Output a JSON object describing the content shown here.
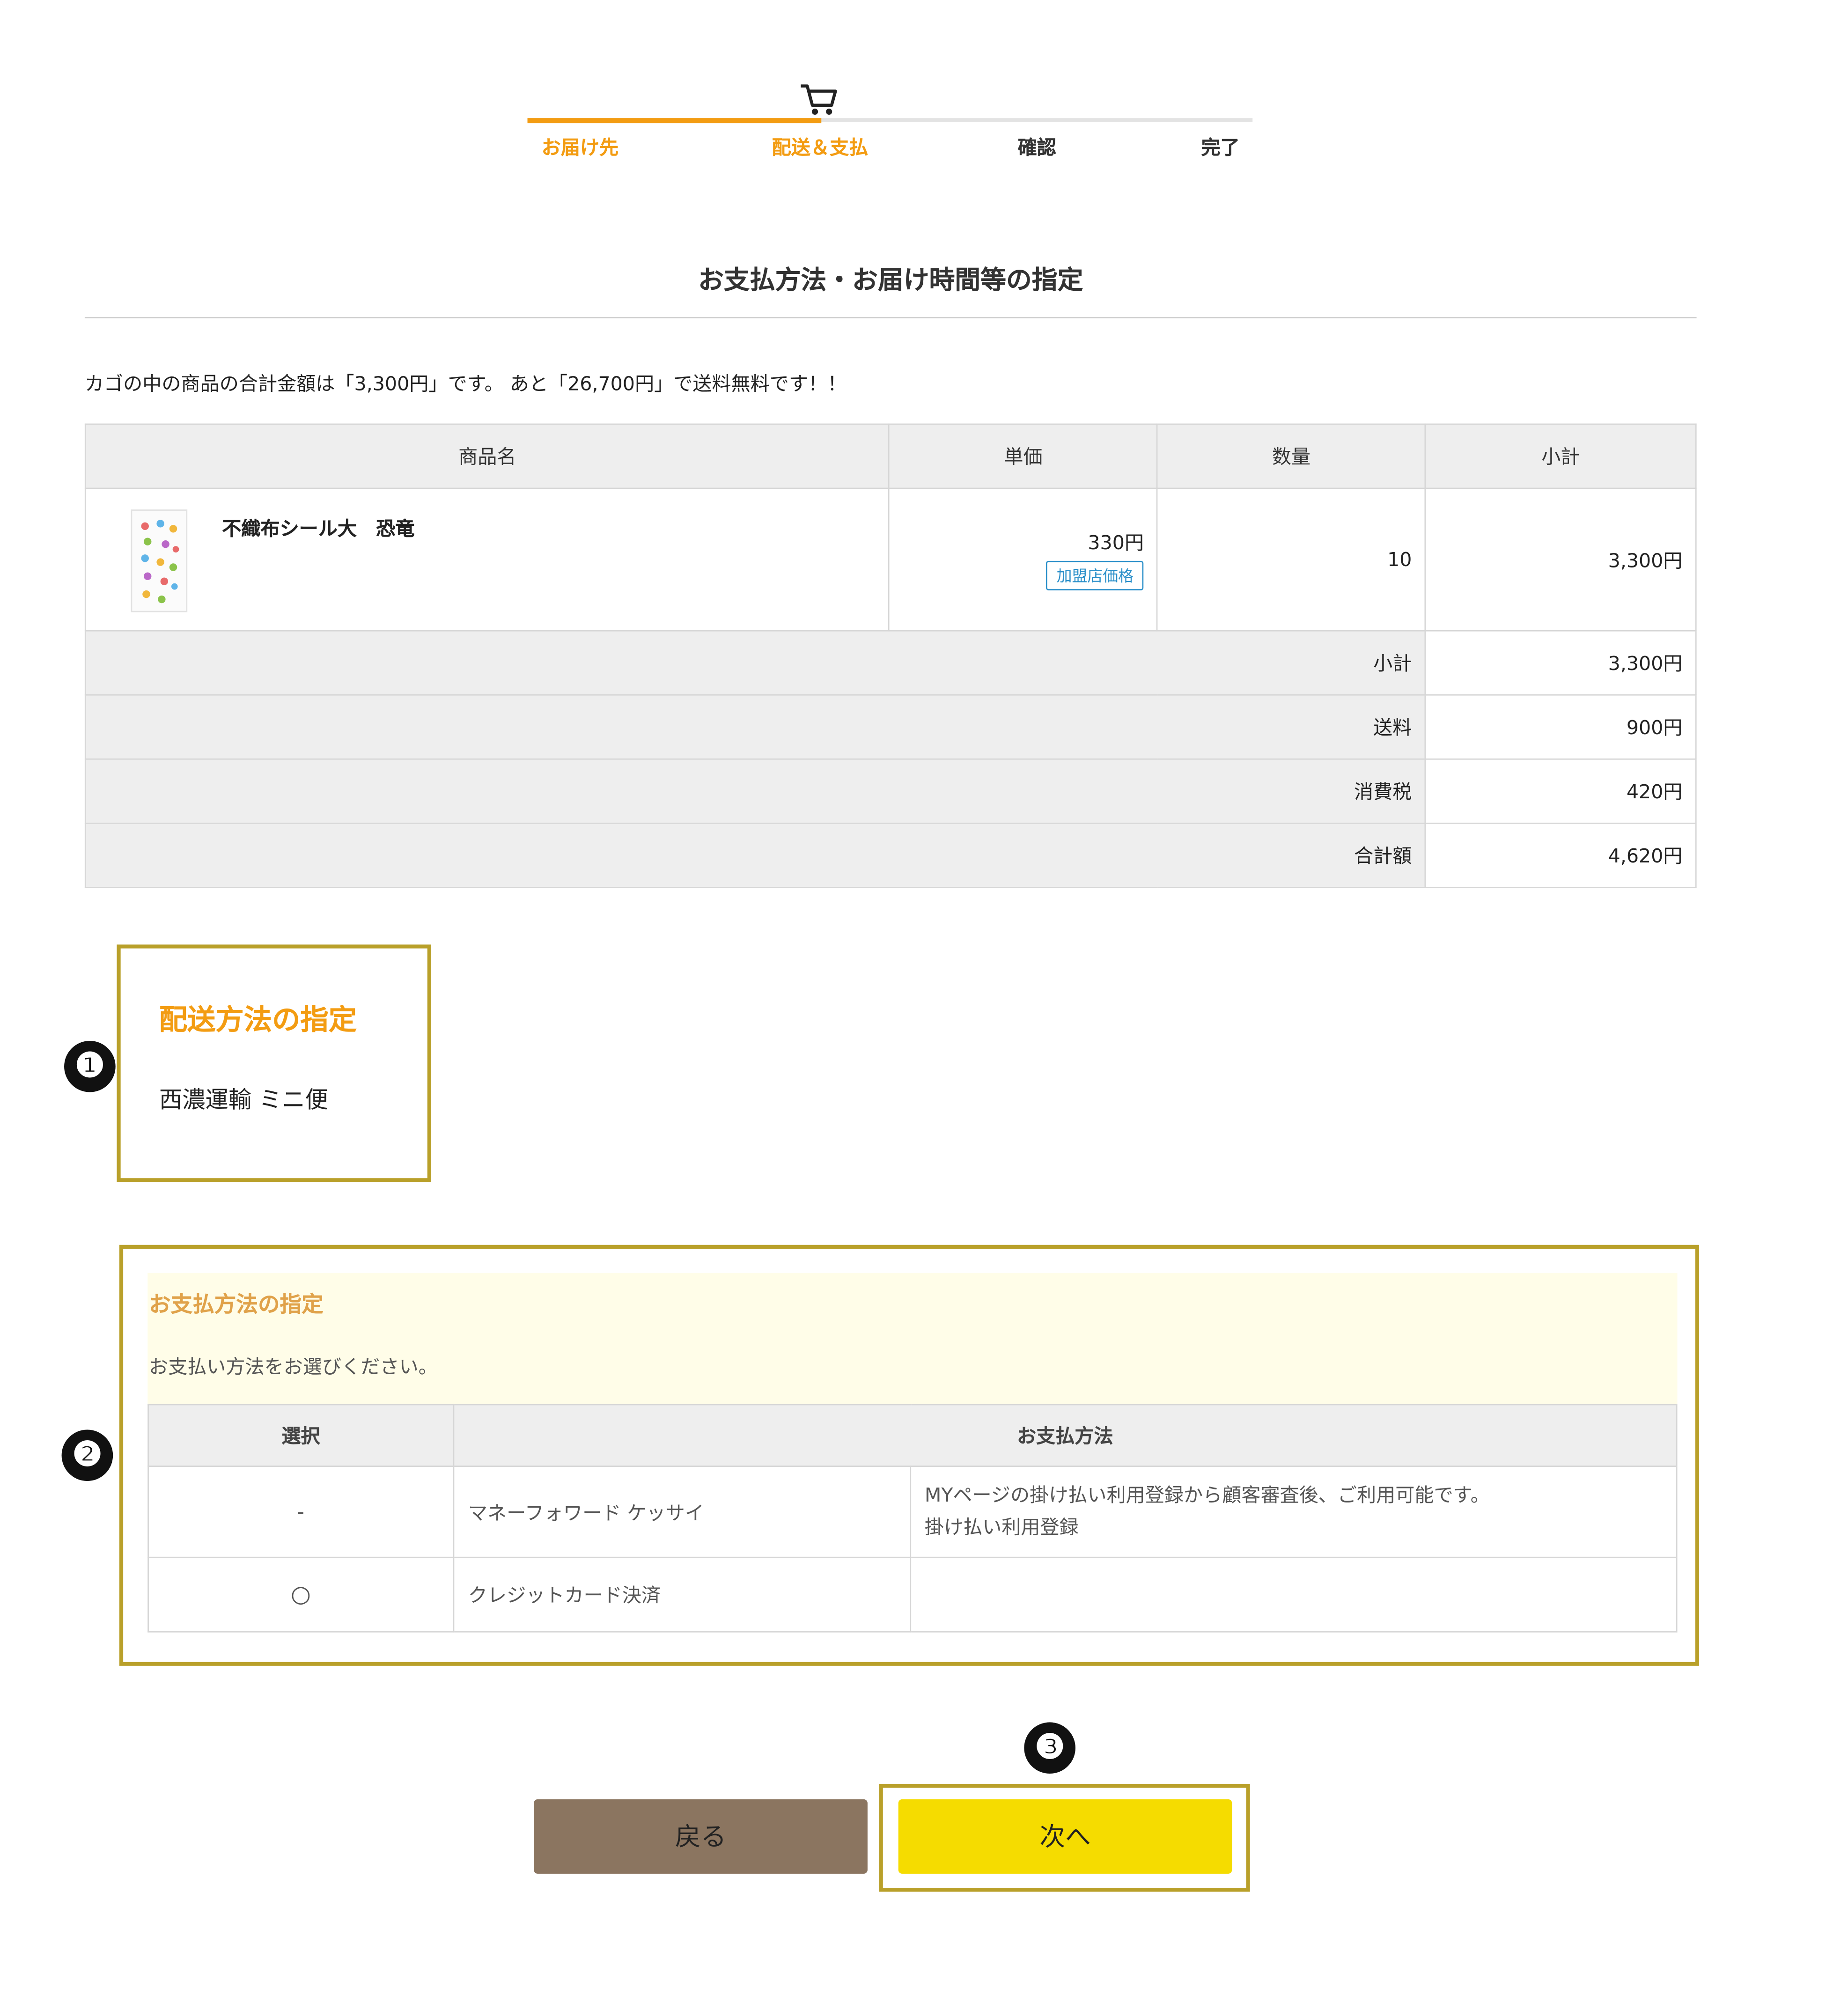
{
  "progress": {
    "steps": [
      {
        "label": "お届け先",
        "state": "done"
      },
      {
        "label": "配送＆支払",
        "state": "current"
      },
      {
        "label": "確認",
        "state": "pending"
      },
      {
        "label": "完了",
        "state": "pending"
      }
    ],
    "icon": "cart-icon",
    "active_color": "#f39c12"
  },
  "page_title": "お支払方法・お届け時間等の指定",
  "cart_note": "カゴの中の商品の合計金額は「3,300円」です。 あと「26,700円」で送料無料です！！",
  "cart_table": {
    "headers": [
      "商品名",
      "単価",
      "数量",
      "小計"
    ],
    "items": [
      {
        "name": "不織布シール大　恐竜",
        "unit_price": "330円",
        "price_badge": "加盟店価格",
        "quantity": "10",
        "subtotal": "3,300円"
      }
    ],
    "summary": [
      {
        "label": "小計",
        "value": "3,300円"
      },
      {
        "label": "送料",
        "value": "900円"
      },
      {
        "label": "消費税",
        "value": "420円"
      },
      {
        "label": "合計額",
        "value": "4,620円"
      }
    ]
  },
  "markers": [
    "❶",
    "❷",
    "❸"
  ],
  "delivery": {
    "title": "配送方法の指定",
    "method": "西濃運輸 ミニ便"
  },
  "payment": {
    "title": "お支払方法の指定",
    "instruction": "お支払い方法をお選びください。",
    "headers": [
      "選択",
      "お支払方法"
    ],
    "rows": [
      {
        "select": "-",
        "method": "マネーフォワード ケッサイ",
        "note_line1": "MYページの掛け払い利用登録から顧客審査後、ご利用可能です。",
        "note_line2": "掛け払い利用登録"
      },
      {
        "select": "○",
        "method": "クレジットカード決済",
        "note_line1": "",
        "note_line2": ""
      }
    ]
  },
  "buttons": {
    "back": "戻る",
    "next": "次へ"
  },
  "colors": {
    "highlight_border": "#b9a02a",
    "back_button": "#8b7560",
    "next_button": "#f5dc00",
    "payment_header_bg": "#fffde8"
  }
}
